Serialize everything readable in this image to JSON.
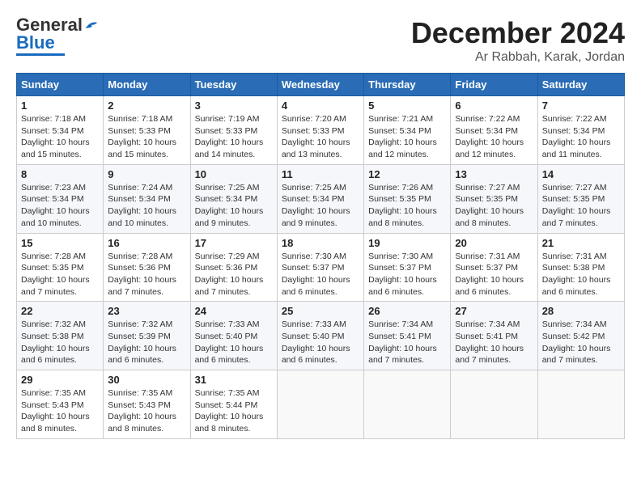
{
  "header": {
    "logo_general": "General",
    "logo_blue": "Blue",
    "month_title": "December 2024",
    "location": "Ar Rabbah, Karak, Jordan"
  },
  "weekdays": [
    "Sunday",
    "Monday",
    "Tuesday",
    "Wednesday",
    "Thursday",
    "Friday",
    "Saturday"
  ],
  "weeks": [
    [
      {
        "day": 1,
        "sunrise": "7:18 AM",
        "sunset": "5:34 PM",
        "daylight": "10 hours and 15 minutes."
      },
      {
        "day": 2,
        "sunrise": "7:18 AM",
        "sunset": "5:33 PM",
        "daylight": "10 hours and 15 minutes."
      },
      {
        "day": 3,
        "sunrise": "7:19 AM",
        "sunset": "5:33 PM",
        "daylight": "10 hours and 14 minutes."
      },
      {
        "day": 4,
        "sunrise": "7:20 AM",
        "sunset": "5:33 PM",
        "daylight": "10 hours and 13 minutes."
      },
      {
        "day": 5,
        "sunrise": "7:21 AM",
        "sunset": "5:34 PM",
        "daylight": "10 hours and 12 minutes."
      },
      {
        "day": 6,
        "sunrise": "7:22 AM",
        "sunset": "5:34 PM",
        "daylight": "10 hours and 12 minutes."
      },
      {
        "day": 7,
        "sunrise": "7:22 AM",
        "sunset": "5:34 PM",
        "daylight": "10 hours and 11 minutes."
      }
    ],
    [
      {
        "day": 8,
        "sunrise": "7:23 AM",
        "sunset": "5:34 PM",
        "daylight": "10 hours and 10 minutes."
      },
      {
        "day": 9,
        "sunrise": "7:24 AM",
        "sunset": "5:34 PM",
        "daylight": "10 hours and 10 minutes."
      },
      {
        "day": 10,
        "sunrise": "7:25 AM",
        "sunset": "5:34 PM",
        "daylight": "10 hours and 9 minutes."
      },
      {
        "day": 11,
        "sunrise": "7:25 AM",
        "sunset": "5:34 PM",
        "daylight": "10 hours and 9 minutes."
      },
      {
        "day": 12,
        "sunrise": "7:26 AM",
        "sunset": "5:35 PM",
        "daylight": "10 hours and 8 minutes."
      },
      {
        "day": 13,
        "sunrise": "7:27 AM",
        "sunset": "5:35 PM",
        "daylight": "10 hours and 8 minutes."
      },
      {
        "day": 14,
        "sunrise": "7:27 AM",
        "sunset": "5:35 PM",
        "daylight": "10 hours and 7 minutes."
      }
    ],
    [
      {
        "day": 15,
        "sunrise": "7:28 AM",
        "sunset": "5:35 PM",
        "daylight": "10 hours and 7 minutes."
      },
      {
        "day": 16,
        "sunrise": "7:28 AM",
        "sunset": "5:36 PM",
        "daylight": "10 hours and 7 minutes."
      },
      {
        "day": 17,
        "sunrise": "7:29 AM",
        "sunset": "5:36 PM",
        "daylight": "10 hours and 7 minutes."
      },
      {
        "day": 18,
        "sunrise": "7:30 AM",
        "sunset": "5:37 PM",
        "daylight": "10 hours and 6 minutes."
      },
      {
        "day": 19,
        "sunrise": "7:30 AM",
        "sunset": "5:37 PM",
        "daylight": "10 hours and 6 minutes."
      },
      {
        "day": 20,
        "sunrise": "7:31 AM",
        "sunset": "5:37 PM",
        "daylight": "10 hours and 6 minutes."
      },
      {
        "day": 21,
        "sunrise": "7:31 AM",
        "sunset": "5:38 PM",
        "daylight": "10 hours and 6 minutes."
      }
    ],
    [
      {
        "day": 22,
        "sunrise": "7:32 AM",
        "sunset": "5:38 PM",
        "daylight": "10 hours and 6 minutes."
      },
      {
        "day": 23,
        "sunrise": "7:32 AM",
        "sunset": "5:39 PM",
        "daylight": "10 hours and 6 minutes."
      },
      {
        "day": 24,
        "sunrise": "7:33 AM",
        "sunset": "5:40 PM",
        "daylight": "10 hours and 6 minutes."
      },
      {
        "day": 25,
        "sunrise": "7:33 AM",
        "sunset": "5:40 PM",
        "daylight": "10 hours and 6 minutes."
      },
      {
        "day": 26,
        "sunrise": "7:34 AM",
        "sunset": "5:41 PM",
        "daylight": "10 hours and 7 minutes."
      },
      {
        "day": 27,
        "sunrise": "7:34 AM",
        "sunset": "5:41 PM",
        "daylight": "10 hours and 7 minutes."
      },
      {
        "day": 28,
        "sunrise": "7:34 AM",
        "sunset": "5:42 PM",
        "daylight": "10 hours and 7 minutes."
      }
    ],
    [
      {
        "day": 29,
        "sunrise": "7:35 AM",
        "sunset": "5:43 PM",
        "daylight": "10 hours and 8 minutes."
      },
      {
        "day": 30,
        "sunrise": "7:35 AM",
        "sunset": "5:43 PM",
        "daylight": "10 hours and 8 minutes."
      },
      {
        "day": 31,
        "sunrise": "7:35 AM",
        "sunset": "5:44 PM",
        "daylight": "10 hours and 8 minutes."
      },
      null,
      null,
      null,
      null
    ]
  ]
}
